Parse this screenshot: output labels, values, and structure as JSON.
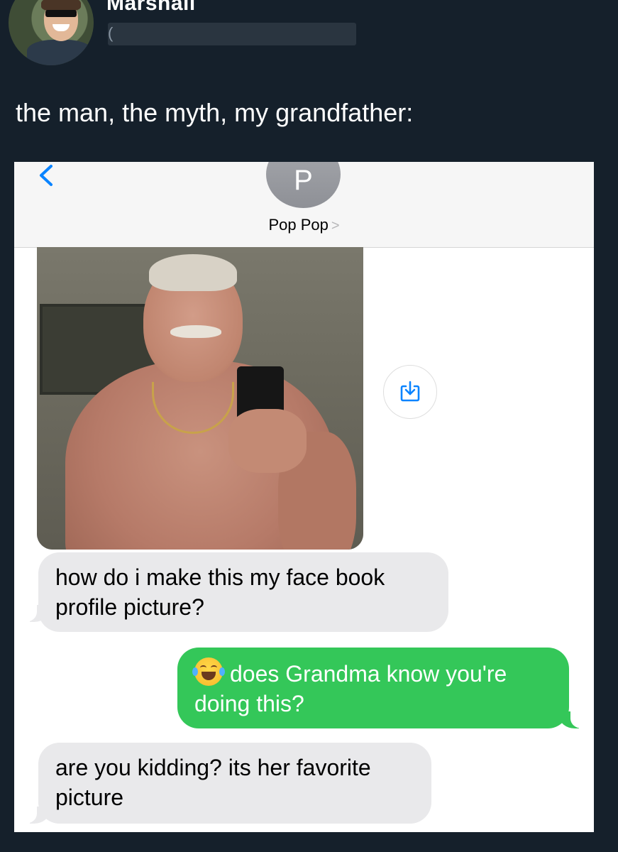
{
  "tweet": {
    "display_name": "Marshall",
    "handle_visible": "(",
    "text": "the man, the myth, my grandfather:"
  },
  "messages_screen": {
    "contact_initial": "P",
    "contact_name": "Pop Pop",
    "contact_chevron": ">",
    "icons": {
      "back": "chevron-left-icon",
      "save": "save-download-icon",
      "emoji": "face-with-tears-of-joy-icon"
    },
    "colors": {
      "incoming_bubble": "#e9e9eb",
      "outgoing_bubble": "#34c759",
      "link_blue": "#0a84ff"
    },
    "messages": [
      {
        "direction": "incoming",
        "text": "how do i make this my face book profile picture?"
      },
      {
        "direction": "outgoing",
        "emoji": "😂",
        "text": "does Grandma know you're doing this?"
      },
      {
        "direction": "incoming",
        "text": "are you kidding? its her favorite picture"
      }
    ]
  }
}
